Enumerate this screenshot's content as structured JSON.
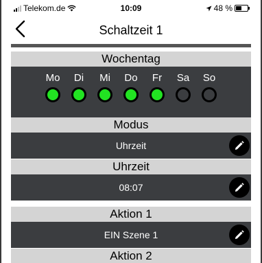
{
  "status": {
    "carrier": "Telekom.de",
    "time": "10:09",
    "battery": "48 %",
    "battery_level": 0.48
  },
  "nav": {
    "title": "Schaltzeit 1"
  },
  "weekday": {
    "header": "Wochentag",
    "days": [
      {
        "label": "Mo",
        "on": true
      },
      {
        "label": "Di",
        "on": true
      },
      {
        "label": "Mi",
        "on": true
      },
      {
        "label": "Do",
        "on": true
      },
      {
        "label": "Fr",
        "on": true
      },
      {
        "label": "Sa",
        "on": false
      },
      {
        "label": "So",
        "on": false
      }
    ],
    "active_color": "#22e322"
  },
  "modus": {
    "header": "Modus",
    "value": "Uhrzeit"
  },
  "uhrzeit": {
    "header": "Uhrzeit",
    "value": "08:07"
  },
  "aktion1": {
    "header": "Aktion 1",
    "value": "EIN Szene 1"
  },
  "aktion2": {
    "header": "Aktion 2"
  }
}
